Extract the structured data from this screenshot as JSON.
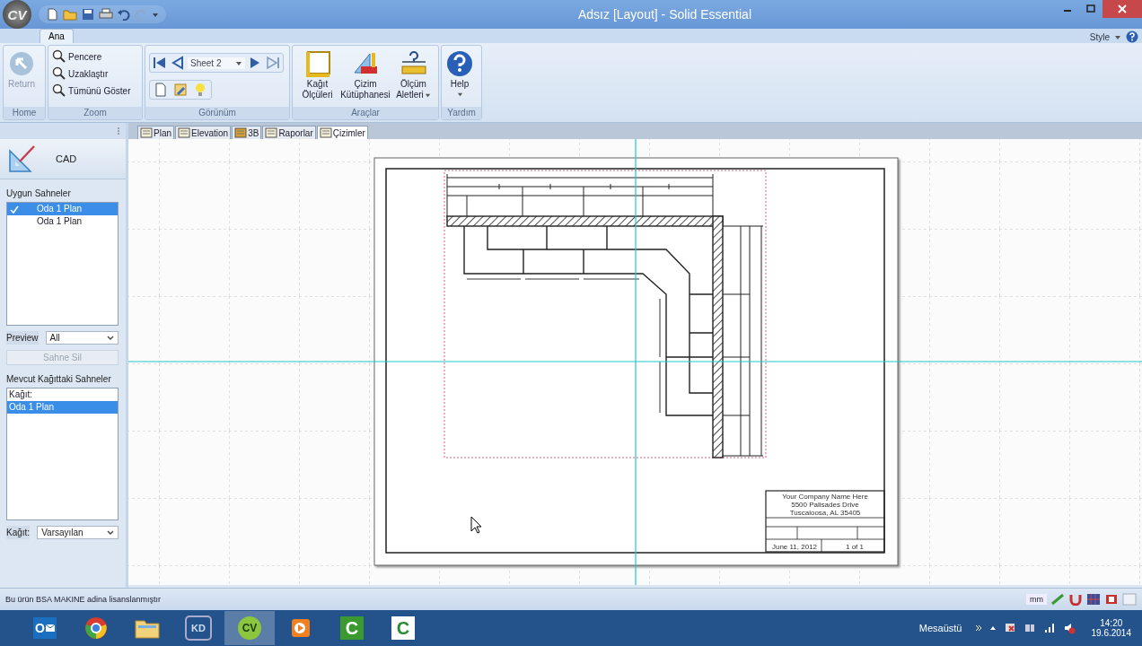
{
  "window": {
    "title": "Adsız [Layout] - Solid Essential",
    "app_logo": "CV"
  },
  "ribbon_tabs": [
    {
      "label": "Ana",
      "selected": true
    }
  ],
  "style_menu": "Style",
  "ribbon": {
    "home": {
      "title": "Home",
      "return_button": {
        "label": "Return",
        "disabled": true
      }
    },
    "zoom": {
      "title": "Zoom",
      "items": [
        "Pencere",
        "Uzaklaştır",
        "Tümünü Göster"
      ]
    },
    "view": {
      "title": "Görünüm",
      "sheet": "Sheet 2"
    },
    "tools": {
      "title": "Araçlar",
      "buttons": [
        {
          "kind": "paper",
          "label": "Kağıt\nÖlçüleri",
          "dropdown": false
        },
        {
          "kind": "library",
          "label": "Çizim\nKütüphanesi",
          "dropdown": false
        },
        {
          "kind": "measure",
          "label": "Ölçüm\nAletleri",
          "dropdown": true
        }
      ]
    },
    "help": {
      "title": "Yardım",
      "label": "Help"
    }
  },
  "doc_tabs": [
    {
      "label": "Plan",
      "selected": false
    },
    {
      "label": "Elevation",
      "selected": false
    },
    {
      "label": "3B",
      "selected": false
    },
    {
      "label": "Raporlar",
      "selected": false
    },
    {
      "label": "Çizimler",
      "selected": true
    }
  ],
  "sidebar": {
    "title": "CAD",
    "scenes_label": "Uygun Sahneler",
    "scenes": [
      {
        "label": "Oda 1 Plan",
        "selected": true,
        "checked": true
      },
      {
        "label": "Oda 1 Plan",
        "selected": false,
        "checked": false
      }
    ],
    "preview_label": "Preview",
    "preview_value": "All",
    "delete_button": {
      "label": "Sahne Sil",
      "disabled": true
    },
    "paper_scenes_label": "Mevcut Kağıttaki Sahneler",
    "paper_scenes": [
      {
        "label": "Kağıt:",
        "selected": false
      },
      {
        "label": "Oda 1 Plan",
        "selected": true
      }
    ],
    "paper_label": "Kağıt:",
    "paper_value": "Varsayılan"
  },
  "title_block": {
    "lines": [
      "Your Company Name Here",
      "5500 Palisades Drive",
      "Tuscaloosa, AL 35405"
    ],
    "date": "June 11, 2012",
    "sheet": "1 of 1"
  },
  "status_bar": {
    "text": "Bu ürün BSA MAKINE adina lisanslanmıştır",
    "unit": "mm"
  },
  "taskbar": {
    "apps": [
      {
        "kind": "mail",
        "glyph": "O",
        "active": false
      },
      {
        "kind": "browser",
        "active": false
      },
      {
        "kind": "folder",
        "active": false
      },
      {
        "kind": "badge",
        "glyph": "KD",
        "active": false
      },
      {
        "kind": "logo",
        "glyph": "CV",
        "active": true
      },
      {
        "kind": "player",
        "active": false
      },
      {
        "kind": "green",
        "glyph": "C",
        "active": false
      },
      {
        "kind": "white",
        "glyph": "C",
        "active": false
      }
    ],
    "desktop_label": "Mesaüstü",
    "time": "14:20",
    "date": "19.6.2014"
  }
}
